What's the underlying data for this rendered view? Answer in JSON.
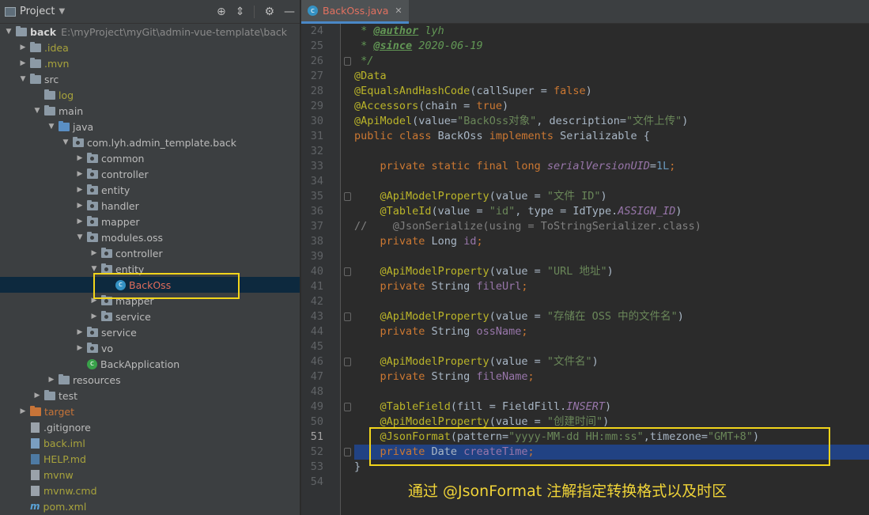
{
  "project_panel": {
    "title": "Project",
    "tree": [
      {
        "depth": 0,
        "arrow": "▼",
        "icon": "folder",
        "label": "back",
        "style": "bold",
        "path": "E:\\myProject\\myGit\\admin-vue-template\\back"
      },
      {
        "depth": 1,
        "arrow": "▶",
        "icon": "folder",
        "label": ".idea",
        "style": "olive"
      },
      {
        "depth": 1,
        "arrow": "▶",
        "icon": "folder",
        "label": ".mvn",
        "style": "olive"
      },
      {
        "depth": 1,
        "arrow": "▼",
        "icon": "folder",
        "label": "src"
      },
      {
        "depth": 2,
        "arrow": "",
        "icon": "folder",
        "label": "log",
        "style": "olive"
      },
      {
        "depth": 2,
        "arrow": "▼",
        "icon": "folder",
        "label": "main"
      },
      {
        "depth": 3,
        "arrow": "▼",
        "icon": "folder-src",
        "label": "java"
      },
      {
        "depth": 4,
        "arrow": "▼",
        "icon": "folder-pkg",
        "label": "com.lyh.admin_template.back"
      },
      {
        "depth": 5,
        "arrow": "▶",
        "icon": "folder-pkg",
        "label": "common"
      },
      {
        "depth": 5,
        "arrow": "▶",
        "icon": "folder-pkg",
        "label": "controller"
      },
      {
        "depth": 5,
        "arrow": "▶",
        "icon": "folder-pkg",
        "label": "entity"
      },
      {
        "depth": 5,
        "arrow": "▶",
        "icon": "folder-pkg",
        "label": "handler"
      },
      {
        "depth": 5,
        "arrow": "▶",
        "icon": "folder-pkg",
        "label": "mapper"
      },
      {
        "depth": 5,
        "arrow": "▼",
        "icon": "folder-pkg",
        "label": "modules.oss"
      },
      {
        "depth": 6,
        "arrow": "▶",
        "icon": "folder-pkg",
        "label": "controller"
      },
      {
        "depth": 6,
        "arrow": "▼",
        "icon": "folder-pkg",
        "label": "entity"
      },
      {
        "depth": 7,
        "arrow": "",
        "icon": "class",
        "label": "BackOss",
        "style": "red",
        "selected": true
      },
      {
        "depth": 6,
        "arrow": "▶",
        "icon": "folder-pkg",
        "label": "mapper"
      },
      {
        "depth": 6,
        "arrow": "▶",
        "icon": "folder-pkg",
        "label": "service"
      },
      {
        "depth": 5,
        "arrow": "▶",
        "icon": "folder-pkg",
        "label": "service"
      },
      {
        "depth": 5,
        "arrow": "▶",
        "icon": "folder-pkg",
        "label": "vo"
      },
      {
        "depth": 5,
        "arrow": "",
        "icon": "class-app",
        "label": "BackApplication"
      },
      {
        "depth": 3,
        "arrow": "▶",
        "icon": "folder",
        "label": "resources"
      },
      {
        "depth": 2,
        "arrow": "▶",
        "icon": "folder",
        "label": "test"
      },
      {
        "depth": 1,
        "arrow": "▶",
        "icon": "folder-orange",
        "label": "target",
        "style": "orange"
      },
      {
        "depth": 1,
        "arrow": "",
        "icon": "file",
        "label": ".gitignore"
      },
      {
        "depth": 1,
        "arrow": "",
        "icon": "file-blue",
        "label": "back.iml",
        "style": "olive"
      },
      {
        "depth": 1,
        "arrow": "",
        "icon": "file-md",
        "label": "HELP.md",
        "style": "olive"
      },
      {
        "depth": 1,
        "arrow": "",
        "icon": "file",
        "label": "mvnw",
        "style": "olive"
      },
      {
        "depth": 1,
        "arrow": "",
        "icon": "file",
        "label": "mvnw.cmd",
        "style": "olive"
      },
      {
        "depth": 1,
        "arrow": "",
        "icon": "maven",
        "label": "pom.xml",
        "style": "olive"
      }
    ]
  },
  "editor": {
    "tab_label": "BackOss.java",
    "highlighted_line": 51,
    "selected_line": 52,
    "lines": [
      {
        "n": "24",
        "fold": false,
        "t": [
          [
            "cmi",
            " * "
          ],
          [
            "dtag",
            "@author"
          ],
          [
            "cmi",
            " lyh"
          ]
        ]
      },
      {
        "n": "25",
        "fold": false,
        "t": [
          [
            "cmi",
            " * "
          ],
          [
            "dtag",
            "@since"
          ],
          [
            "cmi",
            " 2020-06-19"
          ]
        ]
      },
      {
        "n": "26",
        "fold": true,
        "t": [
          [
            "cmi",
            " */"
          ]
        ]
      },
      {
        "n": "27",
        "fold": false,
        "t": [
          [
            "an",
            "@Data"
          ]
        ]
      },
      {
        "n": "28",
        "fold": false,
        "t": [
          [
            "an",
            "@EqualsAndHashCode"
          ],
          [
            "ident",
            "(callSuper = "
          ],
          [
            "kw",
            "false"
          ],
          [
            "ident",
            ")"
          ]
        ]
      },
      {
        "n": "29",
        "fold": false,
        "t": [
          [
            "an",
            "@Accessors"
          ],
          [
            "ident",
            "(chain = "
          ],
          [
            "kw",
            "true"
          ],
          [
            "ident",
            ")"
          ]
        ]
      },
      {
        "n": "30",
        "fold": false,
        "t": [
          [
            "an",
            "@ApiModel"
          ],
          [
            "ident",
            "(value="
          ],
          [
            "str",
            "\"BackOss对象\""
          ],
          [
            "ident",
            ", description="
          ],
          [
            "str",
            "\"文件上传\""
          ],
          [
            "ident",
            ")"
          ]
        ]
      },
      {
        "n": "31",
        "fold": false,
        "t": [
          [
            "kw",
            "public class "
          ],
          [
            "ident",
            "BackOss "
          ],
          [
            "kw",
            "implements "
          ],
          [
            "ident",
            "Serializable {"
          ]
        ]
      },
      {
        "n": "32",
        "fold": false,
        "t": []
      },
      {
        "n": "33",
        "fold": false,
        "t": [
          [
            "kw",
            "    private static final long "
          ],
          [
            "fldi",
            "serialVersionUID"
          ],
          [
            "ident",
            "="
          ],
          [
            "num",
            "1L"
          ],
          [
            "kw",
            ";"
          ]
        ]
      },
      {
        "n": "34",
        "fold": false,
        "t": []
      },
      {
        "n": "35",
        "fold": true,
        "t": [
          [
            "an",
            "    @ApiModelProperty"
          ],
          [
            "ident",
            "(value = "
          ],
          [
            "str",
            "\"文件 ID\""
          ],
          [
            "ident",
            ")"
          ]
        ]
      },
      {
        "n": "36",
        "fold": false,
        "t": [
          [
            "an",
            "    @TableId"
          ],
          [
            "ident",
            "(value = "
          ],
          [
            "str",
            "\"id\""
          ],
          [
            "ident",
            ", type = IdType."
          ],
          [
            "fldi",
            "ASSIGN_ID"
          ],
          [
            "ident",
            ")"
          ]
        ]
      },
      {
        "n": "37",
        "fold": false,
        "t": [
          [
            "cm",
            "//    @JsonSerialize(using = ToStringSerializer.class)"
          ]
        ]
      },
      {
        "n": "38",
        "fold": false,
        "t": [
          [
            "kw",
            "    private "
          ],
          [
            "ident",
            "Long "
          ],
          [
            "fld",
            "id"
          ],
          [
            "kw",
            ";"
          ]
        ]
      },
      {
        "n": "39",
        "fold": false,
        "t": []
      },
      {
        "n": "40",
        "fold": true,
        "t": [
          [
            "an",
            "    @ApiModelProperty"
          ],
          [
            "ident",
            "(value = "
          ],
          [
            "str",
            "\"URL 地址\""
          ],
          [
            "ident",
            ")"
          ]
        ]
      },
      {
        "n": "41",
        "fold": false,
        "t": [
          [
            "kw",
            "    private "
          ],
          [
            "ident",
            "String "
          ],
          [
            "fld",
            "fileUrl"
          ],
          [
            "kw",
            ";"
          ]
        ]
      },
      {
        "n": "42",
        "fold": false,
        "t": []
      },
      {
        "n": "43",
        "fold": true,
        "t": [
          [
            "an",
            "    @ApiModelProperty"
          ],
          [
            "ident",
            "(value = "
          ],
          [
            "str",
            "\"存储在 OSS 中的文件名\""
          ],
          [
            "ident",
            ")"
          ]
        ]
      },
      {
        "n": "44",
        "fold": false,
        "t": [
          [
            "kw",
            "    private "
          ],
          [
            "ident",
            "String "
          ],
          [
            "fld",
            "ossName"
          ],
          [
            "kw",
            ";"
          ]
        ]
      },
      {
        "n": "45",
        "fold": false,
        "t": []
      },
      {
        "n": "46",
        "fold": true,
        "t": [
          [
            "an",
            "    @ApiModelProperty"
          ],
          [
            "ident",
            "(value = "
          ],
          [
            "str",
            "\"文件名\""
          ],
          [
            "ident",
            ")"
          ]
        ]
      },
      {
        "n": "47",
        "fold": false,
        "t": [
          [
            "kw",
            "    private "
          ],
          [
            "ident",
            "String "
          ],
          [
            "fld",
            "fileName"
          ],
          [
            "kw",
            ";"
          ]
        ]
      },
      {
        "n": "48",
        "fold": false,
        "t": []
      },
      {
        "n": "49",
        "fold": true,
        "t": [
          [
            "an",
            "    @TableField"
          ],
          [
            "ident",
            "(fill = FieldFill."
          ],
          [
            "fldi",
            "INSERT"
          ],
          [
            "ident",
            ")"
          ]
        ]
      },
      {
        "n": "50",
        "fold": false,
        "t": [
          [
            "an",
            "    @ApiModelProperty"
          ],
          [
            "ident",
            "(value = "
          ],
          [
            "str",
            "\"创建时间\""
          ],
          [
            "ident",
            ")"
          ]
        ]
      },
      {
        "n": "51",
        "fold": false,
        "t": [
          [
            "an",
            "    @JsonFormat"
          ],
          [
            "ident",
            "(pattern="
          ],
          [
            "str",
            "\"yyyy-MM-dd HH:mm:ss\""
          ],
          [
            "ident",
            ",timezone="
          ],
          [
            "str",
            "\"GMT+8\""
          ],
          [
            "ident",
            ")"
          ]
        ]
      },
      {
        "n": "52",
        "fold": true,
        "t": [
          [
            "kw",
            "    private "
          ],
          [
            "ident",
            "Date "
          ],
          [
            "fld",
            "createTime"
          ],
          [
            "kw",
            ";"
          ]
        ]
      },
      {
        "n": "53",
        "fold": false,
        "t": [
          [
            "ident",
            "}"
          ]
        ]
      },
      {
        "n": "54",
        "fold": false,
        "t": []
      }
    ]
  },
  "annotation": {
    "caption": "通过 @JsonFormat 注解指定转换格式以及时区",
    "box_color": "#f2d51b"
  }
}
